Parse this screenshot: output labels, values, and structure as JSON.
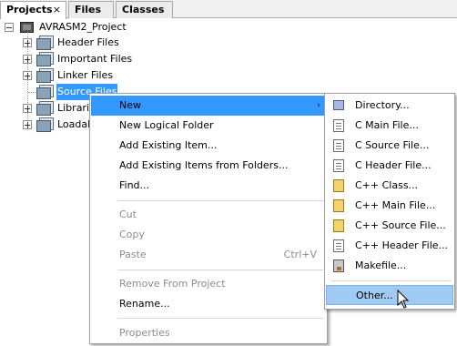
{
  "tabs": [
    {
      "label": "Projects",
      "active": true,
      "close": "×"
    },
    {
      "label": "Files",
      "active": false
    },
    {
      "label": "Classes",
      "active": false
    }
  ],
  "tree": {
    "project": "AVRASM2_Project",
    "items": [
      {
        "label": "Header Files"
      },
      {
        "label": "Important Files"
      },
      {
        "label": "Linker Files"
      },
      {
        "label": "Source Files",
        "selected": true
      },
      {
        "label": "Libraries"
      },
      {
        "label": "Loadables"
      }
    ]
  },
  "context_menu": {
    "items": [
      {
        "label": "New",
        "highlighted": true,
        "submenu": true
      },
      {
        "label": "New Logical Folder"
      },
      {
        "label": "Add Existing Item..."
      },
      {
        "label": "Add Existing Items from Folders..."
      },
      {
        "label": "Find..."
      },
      {
        "label": "Cut",
        "disabled": true
      },
      {
        "label": "Copy",
        "disabled": true
      },
      {
        "label": "Paste",
        "disabled": true,
        "accel": "Ctrl+V"
      },
      {
        "label": "Remove From Project",
        "disabled": true
      },
      {
        "label": "Rename..."
      },
      {
        "label": "Properties",
        "disabled": true
      }
    ],
    "arrow": "›"
  },
  "submenu": {
    "items": [
      {
        "label": "Directory...",
        "icon": "directory-icon"
      },
      {
        "label": "C Main File...",
        "icon": "c-file-icon"
      },
      {
        "label": "C Source File...",
        "icon": "c-file-icon"
      },
      {
        "label": "C Header File...",
        "icon": "header-file-icon"
      },
      {
        "label": "C++ Class...",
        "icon": "cpp-class-icon"
      },
      {
        "label": "C++ Main File...",
        "icon": "cpp-class-icon"
      },
      {
        "label": "C++ Source File...",
        "icon": "cpp-class-icon"
      },
      {
        "label": "C++ Header File...",
        "icon": "header-file-icon"
      },
      {
        "label": "Makefile...",
        "icon": "makefile-icon"
      },
      {
        "label": "Other...",
        "icon": "",
        "highlighted": true
      }
    ]
  },
  "colors": {
    "selection": "#3399ff",
    "submenu_hover": "#9fcbf3",
    "disabled_text": "#8c8c8c"
  }
}
